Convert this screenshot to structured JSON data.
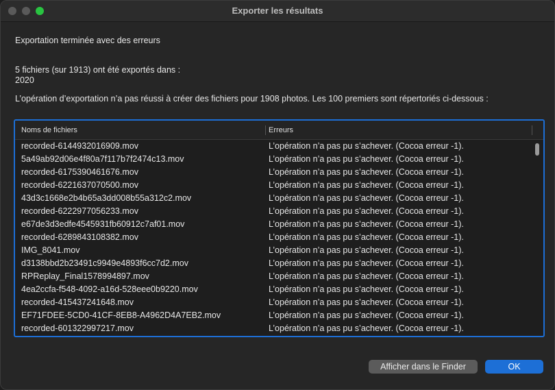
{
  "window": {
    "title": "Exporter les résultats"
  },
  "dialog": {
    "status": "Exportation terminée avec des erreurs",
    "summary_line1": "5 fichiers (sur 1913) ont été exportés dans :",
    "summary_line2": "2020",
    "failure_message": "L’opération d’exportation n’a pas réussi à créer des fichiers pour 1908 photos. Les 100 premiers sont répertoriés ci-dessous :"
  },
  "table": {
    "columns": [
      "Noms de fichiers",
      "Erreurs"
    ],
    "rows": [
      {
        "file": "recorded-6144932016909.mov",
        "error": "L’opération n’a pas pu s’achever. (Cocoa erreur -1)."
      },
      {
        "file": "5a49ab92d06e4f80a7f117b7f2474c13.mov",
        "error": "L’opération n’a pas pu s’achever. (Cocoa erreur -1)."
      },
      {
        "file": "recorded-6175390461676.mov",
        "error": "L’opération n’a pas pu s’achever. (Cocoa erreur -1)."
      },
      {
        "file": "recorded-6221637070500.mov",
        "error": "L’opération n’a pas pu s’achever. (Cocoa erreur -1)."
      },
      {
        "file": "43d3c1668e2b4b65a3dd008b55a312c2.mov",
        "error": "L’opération n’a pas pu s’achever. (Cocoa erreur -1)."
      },
      {
        "file": "recorded-6222977056233.mov",
        "error": "L’opération n’a pas pu s’achever. (Cocoa erreur -1)."
      },
      {
        "file": "e67de3d3edfe4545931fb60912c7af01.mov",
        "error": "L’opération n’a pas pu s’achever. (Cocoa erreur -1)."
      },
      {
        "file": "recorded-6289843108382.mov",
        "error": "L’opération n’a pas pu s’achever. (Cocoa erreur -1)."
      },
      {
        "file": "IMG_8041.mov",
        "error": "L’opération n’a pas pu s’achever. (Cocoa erreur -1)."
      },
      {
        "file": "d3138bbd2b23491c9949e4893f6cc7d2.mov",
        "error": "L’opération n’a pas pu s’achever. (Cocoa erreur -1)."
      },
      {
        "file": "RPReplay_Final1578994897.mov",
        "error": "L’opération n’a pas pu s’achever. (Cocoa erreur -1)."
      },
      {
        "file": "4ea2ccfa-f548-4092-a16d-528eee0b9220.mov",
        "error": "L’opération n’a pas pu s’achever. (Cocoa erreur -1)."
      },
      {
        "file": "recorded-415437241648.mov",
        "error": "L’opération n’a pas pu s’achever. (Cocoa erreur -1)."
      },
      {
        "file": "EF71FDEE-5CD0-41CF-8EB8-A4962D4A7EB2.mov",
        "error": "L’opération n’a pas pu s’achever. (Cocoa erreur -1)."
      },
      {
        "file": "recorded-601322997217.mov",
        "error": "L’opération n’a pas pu s’achever. (Cocoa erreur -1)."
      }
    ]
  },
  "buttons": {
    "finder": "Afficher dans le Finder",
    "ok": "OK"
  },
  "colors": {
    "accent": "#1d6fd6",
    "maximize": "#29c441"
  }
}
